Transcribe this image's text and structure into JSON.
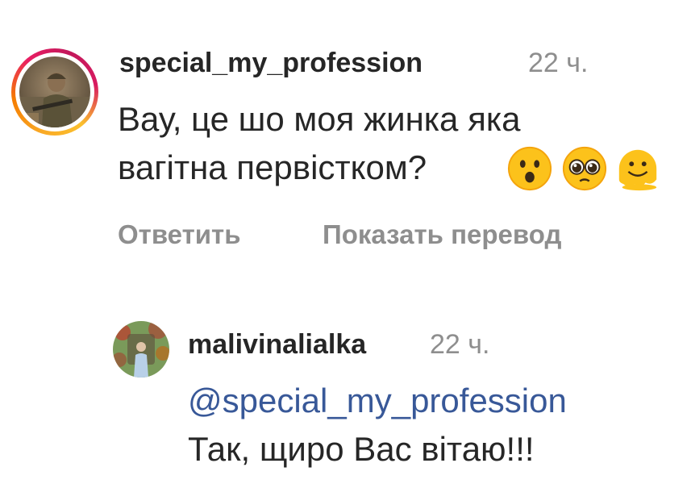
{
  "comment": {
    "username": "special_my_profession",
    "time": "22 ч.",
    "line1": "Вау, це шо моя жинка яка",
    "line2": "вагітна первістком?",
    "emojis": [
      "hushed-face-icon",
      "pleading-face-icon",
      "melting-face-icon"
    ],
    "reply_label": "Ответить",
    "translate_label": "Показать перевод"
  },
  "reply": {
    "username": "malivinalialka",
    "time": "22 ч.",
    "mention": "@special_my_profession",
    "text": "Так, щиро Вас вітаю!!!"
  }
}
